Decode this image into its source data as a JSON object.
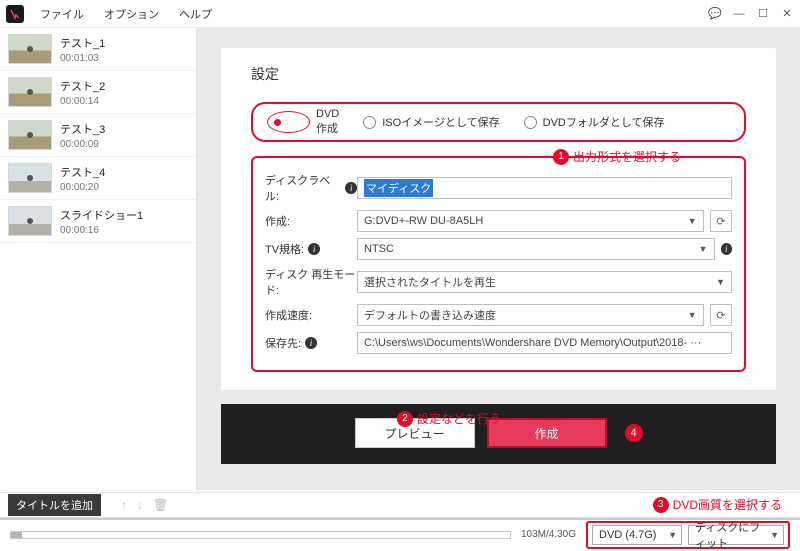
{
  "menu": {
    "file": "ファイル",
    "option": "オプション",
    "help": "ヘルプ"
  },
  "sidebar": {
    "items": [
      {
        "name": "テスト_1",
        "dur": "00:01:03"
      },
      {
        "name": "テスト_2",
        "dur": "00:00:14"
      },
      {
        "name": "テスト_3",
        "dur": "00:00:09"
      },
      {
        "name": "テスト_4",
        "dur": "00:00:20"
      },
      {
        "name": "スライドショー1",
        "dur": "00:00:16"
      }
    ]
  },
  "settings": {
    "title": "設定",
    "formats": {
      "dvd": "DVD作成",
      "iso": "ISOイメージとして保存",
      "folder": "DVDフォルダとして保存"
    },
    "labels": {
      "disclabel": "ディスクラベル:",
      "create": "作成:",
      "tv": "TV規格:",
      "play": "ディスク 再生モード:",
      "speed": "作成速度:",
      "dest": "保存先:"
    },
    "values": {
      "disclabel": "マイディスク",
      "create": "G:DVD+-RW DU-8A5LH",
      "tv": "NTSC",
      "play": "選択されたタイトルを再生",
      "speed": "デフォルトの書き込み速度",
      "dest": "C:\\Users\\ws\\Documents\\Wondershare DVD Memory\\Output\\2018- ···"
    }
  },
  "callouts": {
    "c1": "出力形式を選択する",
    "c2": "設定などを行う",
    "c3": "DVD画質を選択する"
  },
  "actions": {
    "preview": "プレビュー",
    "create": "作成"
  },
  "footer": {
    "add": "タイトルを追加",
    "progress": "103M/4.30G",
    "dvdsize": "DVD (4.7G)",
    "fit": "ディスクにフィット"
  }
}
